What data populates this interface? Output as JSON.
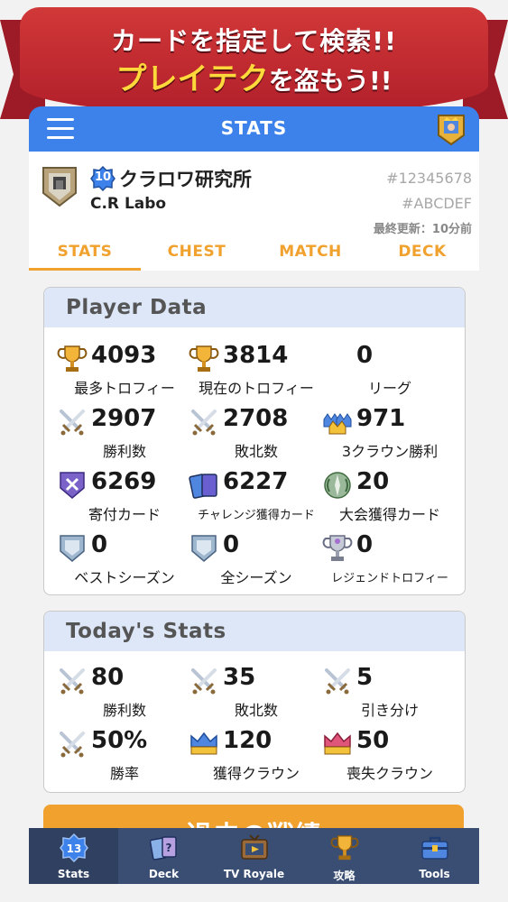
{
  "promo": {
    "line1": "カードを指定して検索!!",
    "line2_highlight": "プレイテク",
    "line2_rest": "を盗もう!!"
  },
  "header": {
    "title": "STATS"
  },
  "profile": {
    "level": "10",
    "name": "クラロワ研究所",
    "clan": "C.R Labo",
    "player_tag": "#12345678",
    "clan_tag": "#ABCDEF",
    "updated": "最終更新：10分前"
  },
  "tabs": [
    "STATS",
    "CHEST",
    "MATCH",
    "DECK"
  ],
  "player_data": {
    "title": "Player Data",
    "items": [
      {
        "value": "4093",
        "label": "最多トロフィー",
        "icon": "trophy-icon"
      },
      {
        "value": "3814",
        "label": "現在のトロフィー",
        "icon": "trophy-icon"
      },
      {
        "value": "0",
        "label": "リーグ",
        "icon": "none"
      },
      {
        "value": "2907",
        "label": "勝利数",
        "icon": "crossed-swords-icon"
      },
      {
        "value": "2708",
        "label": "敗北数",
        "icon": "crossed-swords-icon"
      },
      {
        "value": "971",
        "label": "3クラウン勝利",
        "icon": "three-crowns-icon"
      },
      {
        "value": "6269",
        "label": "寄付カード",
        "icon": "donation-shield-icon"
      },
      {
        "value": "6227",
        "label": "チャレンジ獲得カード",
        "icon": "cards-icon"
      },
      {
        "value": "20",
        "label": "大会獲得カード",
        "icon": "tournament-icon"
      },
      {
        "value": "0",
        "label": "ベストシーズン",
        "icon": "season-shield-icon"
      },
      {
        "value": "0",
        "label": "全シーズン",
        "icon": "season-shield-icon"
      },
      {
        "value": "0",
        "label": "レジェンドトロフィー",
        "icon": "legend-trophy-icon"
      }
    ]
  },
  "today_stats": {
    "title": "Today's Stats",
    "items": [
      {
        "value": "80",
        "label": "勝利数",
        "icon": "crossed-swords-icon"
      },
      {
        "value": "35",
        "label": "敗北数",
        "icon": "crossed-swords-icon"
      },
      {
        "value": "5",
        "label": "引き分け",
        "icon": "crossed-swords-icon"
      },
      {
        "value": "50%",
        "label": "勝率",
        "icon": "crossed-swords-icon"
      },
      {
        "value": "120",
        "label": "獲得クラウン",
        "icon": "blue-crown-icon"
      },
      {
        "value": "50",
        "label": "喪失クラウン",
        "icon": "red-crown-icon"
      }
    ]
  },
  "history_button": {
    "label": "過去の戦績"
  },
  "bottom_nav": [
    {
      "label": "Stats",
      "badge": "13",
      "icon": "stats-badge-icon"
    },
    {
      "label": "Deck",
      "icon": "deck-cards-icon"
    },
    {
      "label": "TV Royale",
      "icon": "tv-icon"
    },
    {
      "label": "攻略",
      "icon": "trophy-icon"
    },
    {
      "label": "Tools",
      "icon": "toolbox-icon"
    }
  ],
  "colors": {
    "primary_blue": "#3d82ea",
    "accent_orange": "#f0a12e",
    "banner_red": "#c62c34",
    "nav_dark": "#3a4e73",
    "panel_header": "#dde7f8"
  }
}
